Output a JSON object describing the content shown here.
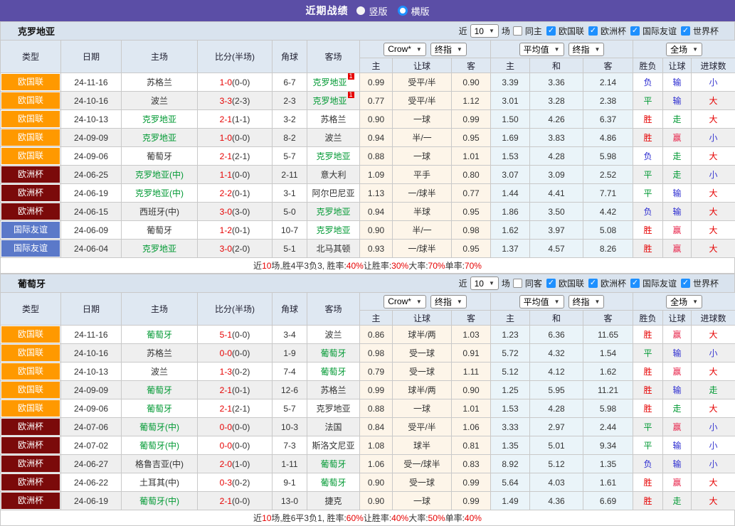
{
  "topbar": {
    "title": "近期战绩",
    "radios": [
      {
        "label": "竖版",
        "selected": false
      },
      {
        "label": "横版",
        "selected": true
      }
    ]
  },
  "filters": {
    "recent_prefix": "近",
    "recent_suffix": "场",
    "leagues": [
      "欧国联",
      "欧洲杯",
      "国际友谊",
      "世界杯"
    ]
  },
  "table_header": {
    "left_cols": [
      "类型",
      "日期",
      "主场",
      "比分(半场)",
      "角球",
      "客场"
    ],
    "odds_selects": [
      "Crow*",
      "终指"
    ],
    "avg_selects": [
      "平均值",
      "终指"
    ],
    "period_selects": [
      "全场"
    ],
    "sub_cols": [
      "主",
      "让球",
      "客",
      "主",
      "和",
      "客",
      "胜负",
      "让球",
      "进球数"
    ]
  },
  "league_colors": {
    "欧国联": "#ff9900",
    "欧洲杯": "#7b0a0a",
    "国际友谊": "#5b79c9"
  },
  "result_colors": {
    "胜": "#e60000",
    "赢": "#e8284e",
    "大": "#e60000",
    "平": "#009933",
    "走": "#009933",
    "负": "#2a2ad0",
    "输": "#2a2ad0",
    "小": "#3a3ad0"
  },
  "team_green": "#009933",
  "summary_red": "#e60000",
  "sections": [
    {
      "team": "克罗地亚",
      "recent_value": "10",
      "same_label": "同主",
      "rows": [
        {
          "league": "欧国联",
          "date": "24-11-16",
          "home": "苏格兰",
          "home_green": false,
          "home_sup": "",
          "score": "1-0",
          "half": "(0-0)",
          "corners": "6-7",
          "away": "克罗地亚",
          "away_green": true,
          "away_sup": "1",
          "odds": [
            "0.99",
            "受平/半",
            "0.90"
          ],
          "avg": [
            "3.39",
            "3.36",
            "2.14"
          ],
          "results": [
            "负",
            "输",
            "小"
          ]
        },
        {
          "league": "欧国联",
          "date": "24-10-16",
          "home": "波兰",
          "home_green": false,
          "home_sup": "",
          "score": "3-3",
          "half": "(2-3)",
          "corners": "2-3",
          "away": "克罗地亚",
          "away_green": true,
          "away_sup": "1",
          "odds": [
            "0.77",
            "受平/半",
            "1.12"
          ],
          "avg": [
            "3.01",
            "3.28",
            "2.38"
          ],
          "results": [
            "平",
            "输",
            "大"
          ]
        },
        {
          "league": "欧国联",
          "date": "24-10-13",
          "home": "克罗地亚",
          "home_green": true,
          "home_sup": "",
          "score": "2-1",
          "half": "(1-1)",
          "corners": "3-2",
          "away": "苏格兰",
          "away_green": false,
          "away_sup": "",
          "odds": [
            "0.90",
            "一球",
            "0.99"
          ],
          "avg": [
            "1.50",
            "4.26",
            "6.37"
          ],
          "results": [
            "胜",
            "走",
            "大"
          ]
        },
        {
          "league": "欧国联",
          "date": "24-09-09",
          "home": "克罗地亚",
          "home_green": true,
          "home_sup": "",
          "score": "1-0",
          "half": "(0-0)",
          "corners": "8-2",
          "away": "波兰",
          "away_green": false,
          "away_sup": "",
          "odds": [
            "0.94",
            "半/一",
            "0.95"
          ],
          "avg": [
            "1.69",
            "3.83",
            "4.86"
          ],
          "results": [
            "胜",
            "赢",
            "小"
          ]
        },
        {
          "league": "欧国联",
          "date": "24-09-06",
          "home": "葡萄牙",
          "home_green": false,
          "home_sup": "",
          "score": "2-1",
          "half": "(2-1)",
          "corners": "5-7",
          "away": "克罗地亚",
          "away_green": true,
          "away_sup": "",
          "odds": [
            "0.88",
            "一球",
            "1.01"
          ],
          "avg": [
            "1.53",
            "4.28",
            "5.98"
          ],
          "results": [
            "负",
            "走",
            "大"
          ]
        },
        {
          "league": "欧洲杯",
          "date": "24-06-25",
          "home": "克罗地亚(中)",
          "home_green": true,
          "home_sup": "",
          "score": "1-1",
          "half": "(0-0)",
          "corners": "2-11",
          "away": "意大利",
          "away_green": false,
          "away_sup": "",
          "odds": [
            "1.09",
            "平手",
            "0.80"
          ],
          "avg": [
            "3.07",
            "3.09",
            "2.52"
          ],
          "results": [
            "平",
            "走",
            "小"
          ]
        },
        {
          "league": "欧洲杯",
          "date": "24-06-19",
          "home": "克罗地亚(中)",
          "home_green": true,
          "home_sup": "",
          "score": "2-2",
          "half": "(0-1)",
          "corners": "3-1",
          "away": "阿尔巴尼亚",
          "away_green": false,
          "away_sup": "",
          "odds": [
            "1.13",
            "一/球半",
            "0.77"
          ],
          "avg": [
            "1.44",
            "4.41",
            "7.71"
          ],
          "results": [
            "平",
            "输",
            "大"
          ]
        },
        {
          "league": "欧洲杯",
          "date": "24-06-15",
          "home": "西班牙(中)",
          "home_green": false,
          "home_sup": "",
          "score": "3-0",
          "half": "(3-0)",
          "corners": "5-0",
          "away": "克罗地亚",
          "away_green": true,
          "away_sup": "",
          "odds": [
            "0.94",
            "半球",
            "0.95"
          ],
          "avg": [
            "1.86",
            "3.50",
            "4.42"
          ],
          "results": [
            "负",
            "输",
            "大"
          ]
        },
        {
          "league": "国际友谊",
          "date": "24-06-09",
          "home": "葡萄牙",
          "home_green": false,
          "home_sup": "",
          "score": "1-2",
          "half": "(0-1)",
          "corners": "10-7",
          "away": "克罗地亚",
          "away_green": true,
          "away_sup": "",
          "odds": [
            "0.90",
            "半/一",
            "0.98"
          ],
          "avg": [
            "1.62",
            "3.97",
            "5.08"
          ],
          "results": [
            "胜",
            "赢",
            "大"
          ]
        },
        {
          "league": "国际友谊",
          "date": "24-06-04",
          "home": "克罗地亚",
          "home_green": true,
          "home_sup": "",
          "score": "3-0",
          "half": "(2-0)",
          "corners": "5-1",
          "away": "北马其顿",
          "away_green": false,
          "away_sup": "",
          "odds": [
            "0.93",
            "一/球半",
            "0.95"
          ],
          "avg": [
            "1.37",
            "4.57",
            "8.26"
          ],
          "results": [
            "胜",
            "赢",
            "大"
          ]
        }
      ],
      "summary": [
        "近",
        "10",
        "场,胜4平3负3, 胜率:",
        "40%",
        " 让胜率:",
        "30%",
        " 大率:",
        "70%",
        " 单率:",
        "70%"
      ]
    },
    {
      "team": "葡萄牙",
      "recent_value": "10",
      "same_label": "同客",
      "rows": [
        {
          "league": "欧国联",
          "date": "24-11-16",
          "home": "葡萄牙",
          "home_green": true,
          "home_sup": "",
          "score": "5-1",
          "half": "(0-0)",
          "corners": "3-4",
          "away": "波兰",
          "away_green": false,
          "away_sup": "",
          "odds": [
            "0.86",
            "球半/两",
            "1.03"
          ],
          "avg": [
            "1.23",
            "6.36",
            "11.65"
          ],
          "results": [
            "胜",
            "赢",
            "大"
          ]
        },
        {
          "league": "欧国联",
          "date": "24-10-16",
          "home": "苏格兰",
          "home_green": false,
          "home_sup": "",
          "score": "0-0",
          "half": "(0-0)",
          "corners": "1-9",
          "away": "葡萄牙",
          "away_green": true,
          "away_sup": "",
          "odds": [
            "0.98",
            "受一球",
            "0.91"
          ],
          "avg": [
            "5.72",
            "4.32",
            "1.54"
          ],
          "results": [
            "平",
            "输",
            "小"
          ]
        },
        {
          "league": "欧国联",
          "date": "24-10-13",
          "home": "波兰",
          "home_green": false,
          "home_sup": "",
          "score": "1-3",
          "half": "(0-2)",
          "corners": "7-4",
          "away": "葡萄牙",
          "away_green": true,
          "away_sup": "",
          "odds": [
            "0.79",
            "受一球",
            "1.11"
          ],
          "avg": [
            "5.12",
            "4.12",
            "1.62"
          ],
          "results": [
            "胜",
            "赢",
            "大"
          ]
        },
        {
          "league": "欧国联",
          "date": "24-09-09",
          "home": "葡萄牙",
          "home_green": true,
          "home_sup": "",
          "score": "2-1",
          "half": "(0-1)",
          "corners": "12-6",
          "away": "苏格兰",
          "away_green": false,
          "away_sup": "",
          "odds": [
            "0.99",
            "球半/两",
            "0.90"
          ],
          "avg": [
            "1.25",
            "5.95",
            "11.21"
          ],
          "results": [
            "胜",
            "输",
            "走"
          ]
        },
        {
          "league": "欧国联",
          "date": "24-09-06",
          "home": "葡萄牙",
          "home_green": true,
          "home_sup": "",
          "score": "2-1",
          "half": "(2-1)",
          "corners": "5-7",
          "away": "克罗地亚",
          "away_green": false,
          "away_sup": "",
          "odds": [
            "0.88",
            "一球",
            "1.01"
          ],
          "avg": [
            "1.53",
            "4.28",
            "5.98"
          ],
          "results": [
            "胜",
            "走",
            "大"
          ]
        },
        {
          "league": "欧洲杯",
          "date": "24-07-06",
          "home": "葡萄牙(中)",
          "home_green": true,
          "home_sup": "",
          "score": "0-0",
          "half": "(0-0)",
          "corners": "10-3",
          "away": "法国",
          "away_green": false,
          "away_sup": "",
          "odds": [
            "0.84",
            "受平/半",
            "1.06"
          ],
          "avg": [
            "3.33",
            "2.97",
            "2.44"
          ],
          "results": [
            "平",
            "赢",
            "小"
          ]
        },
        {
          "league": "欧洲杯",
          "date": "24-07-02",
          "home": "葡萄牙(中)",
          "home_green": true,
          "home_sup": "",
          "score": "0-0",
          "half": "(0-0)",
          "corners": "7-3",
          "away": "斯洛文尼亚",
          "away_green": false,
          "away_sup": "",
          "odds": [
            "1.08",
            "球半",
            "0.81"
          ],
          "avg": [
            "1.35",
            "5.01",
            "9.34"
          ],
          "results": [
            "平",
            "输",
            "小"
          ]
        },
        {
          "league": "欧洲杯",
          "date": "24-06-27",
          "home": "格鲁吉亚(中)",
          "home_green": false,
          "home_sup": "",
          "score": "2-0",
          "half": "(1-0)",
          "corners": "1-11",
          "away": "葡萄牙",
          "away_green": true,
          "away_sup": "",
          "odds": [
            "1.06",
            "受一/球半",
            "0.83"
          ],
          "avg": [
            "8.92",
            "5.12",
            "1.35"
          ],
          "results": [
            "负",
            "输",
            "小"
          ]
        },
        {
          "league": "欧洲杯",
          "date": "24-06-22",
          "home": "土耳其(中)",
          "home_green": false,
          "home_sup": "",
          "score": "0-3",
          "half": "(0-2)",
          "corners": "9-1",
          "away": "葡萄牙",
          "away_green": true,
          "away_sup": "",
          "odds": [
            "0.90",
            "受一球",
            "0.99"
          ],
          "avg": [
            "5.64",
            "4.03",
            "1.61"
          ],
          "results": [
            "胜",
            "赢",
            "大"
          ]
        },
        {
          "league": "欧洲杯",
          "date": "24-06-19",
          "home": "葡萄牙(中)",
          "home_green": true,
          "home_sup": "",
          "score": "2-1",
          "half": "(0-0)",
          "corners": "13-0",
          "away": "捷克",
          "away_green": false,
          "away_sup": "",
          "odds": [
            "0.90",
            "一球",
            "0.99"
          ],
          "avg": [
            "1.49",
            "4.36",
            "6.69"
          ],
          "results": [
            "胜",
            "走",
            "大"
          ]
        }
      ],
      "summary": [
        "近",
        "10",
        "场,胜6平3负1, 胜率:",
        "60%",
        " 让胜率:",
        "40%",
        " 大率:",
        "50%",
        " 单率:",
        "40%"
      ]
    }
  ]
}
